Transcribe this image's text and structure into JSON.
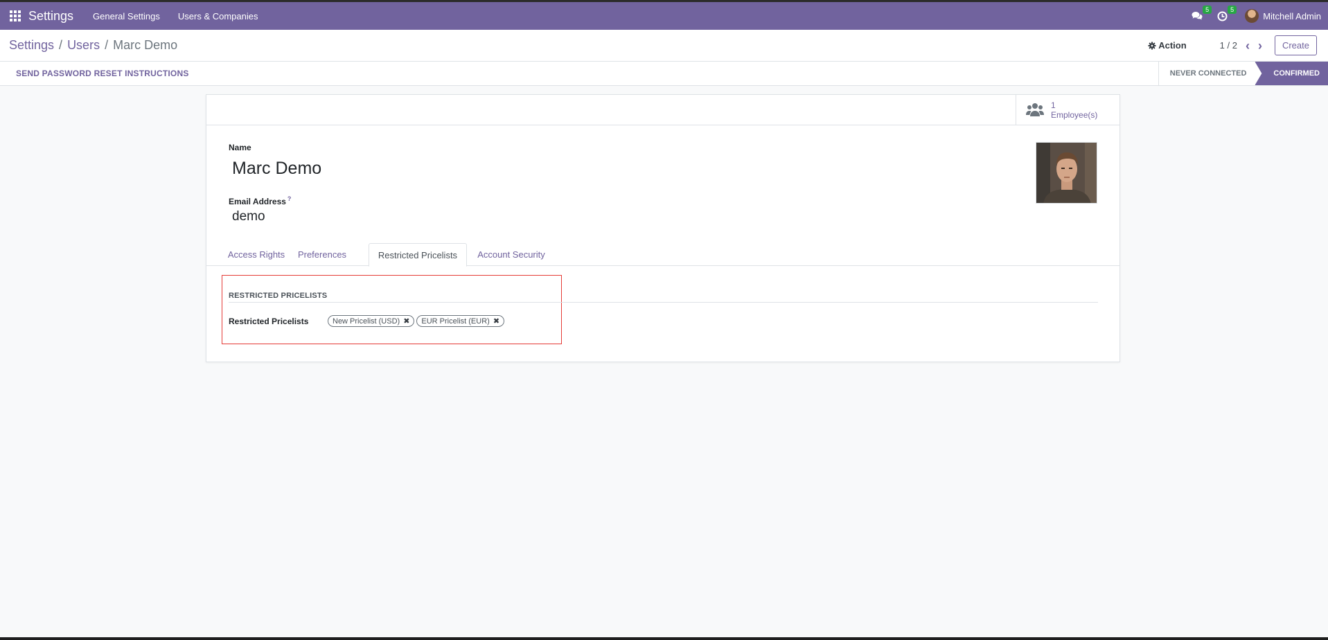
{
  "navbar": {
    "app_name": "Settings",
    "menus": [
      "General Settings",
      "Users & Companies"
    ],
    "messages_badge": "5",
    "activities_badge": "5",
    "user_name": "Mitchell Admin",
    "color": "#71639e"
  },
  "control_panel": {
    "breadcrumbs": [
      "Settings",
      "Users",
      "Marc Demo"
    ],
    "action_label": "Action",
    "pager": "1 / 2",
    "create_label": "Create"
  },
  "statusbar": {
    "reset_label": "SEND PASSWORD RESET INSTRUCTIONS",
    "states": [
      "NEVER CONNECTED",
      "CONFIRMED"
    ],
    "active_state": "CONFIRMED"
  },
  "stat_button": {
    "count": "1",
    "label": "Employee(s)"
  },
  "form": {
    "name_label": "Name",
    "name_value": "Marc Demo",
    "email_label": "Email Address",
    "email_help": "?",
    "email_value": "demo"
  },
  "tabs": [
    "Access Rights",
    "Preferences",
    "Restricted Pricelists",
    "Account Security"
  ],
  "active_tab": "Restricted Pricelists",
  "pricelists": {
    "section_title": "RESTRICTED PRICELISTS",
    "field_label": "Restricted Pricelists",
    "tags": [
      "New Pricelist (USD)",
      "EUR Pricelist (EUR)"
    ]
  },
  "icons": {
    "apps": "apps-grid-icon",
    "messages": "chat-bubbles-icon",
    "activities": "clock-icon",
    "action": "gear-icon",
    "prev": "chevron-left-icon",
    "next": "chevron-right-icon",
    "employees": "users-icon",
    "remove": "close-icon"
  },
  "colors": {
    "accent": "#71639e",
    "badge": "#28a745",
    "highlight": "#e53935"
  }
}
